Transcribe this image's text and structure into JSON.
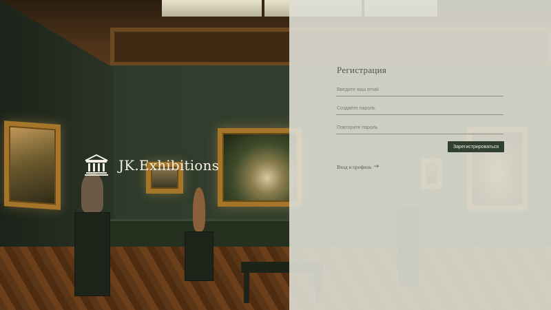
{
  "brand": {
    "name": "JK.Exhibitions",
    "icon": "museum-icon"
  },
  "registration": {
    "title": "Регистрация",
    "email_placeholder": "Введите ваш email",
    "password_placeholder": "Создайте пароль",
    "confirm_placeholder": "Повторите пароль",
    "submit_label": "Зарегистрироваться",
    "login_link_label": "Вход в профиль",
    "login_link_arrow": "→"
  },
  "colors": {
    "accent": "#2f3f30",
    "panel_bg": "#dededa",
    "brand_text": "#f4efe4"
  }
}
